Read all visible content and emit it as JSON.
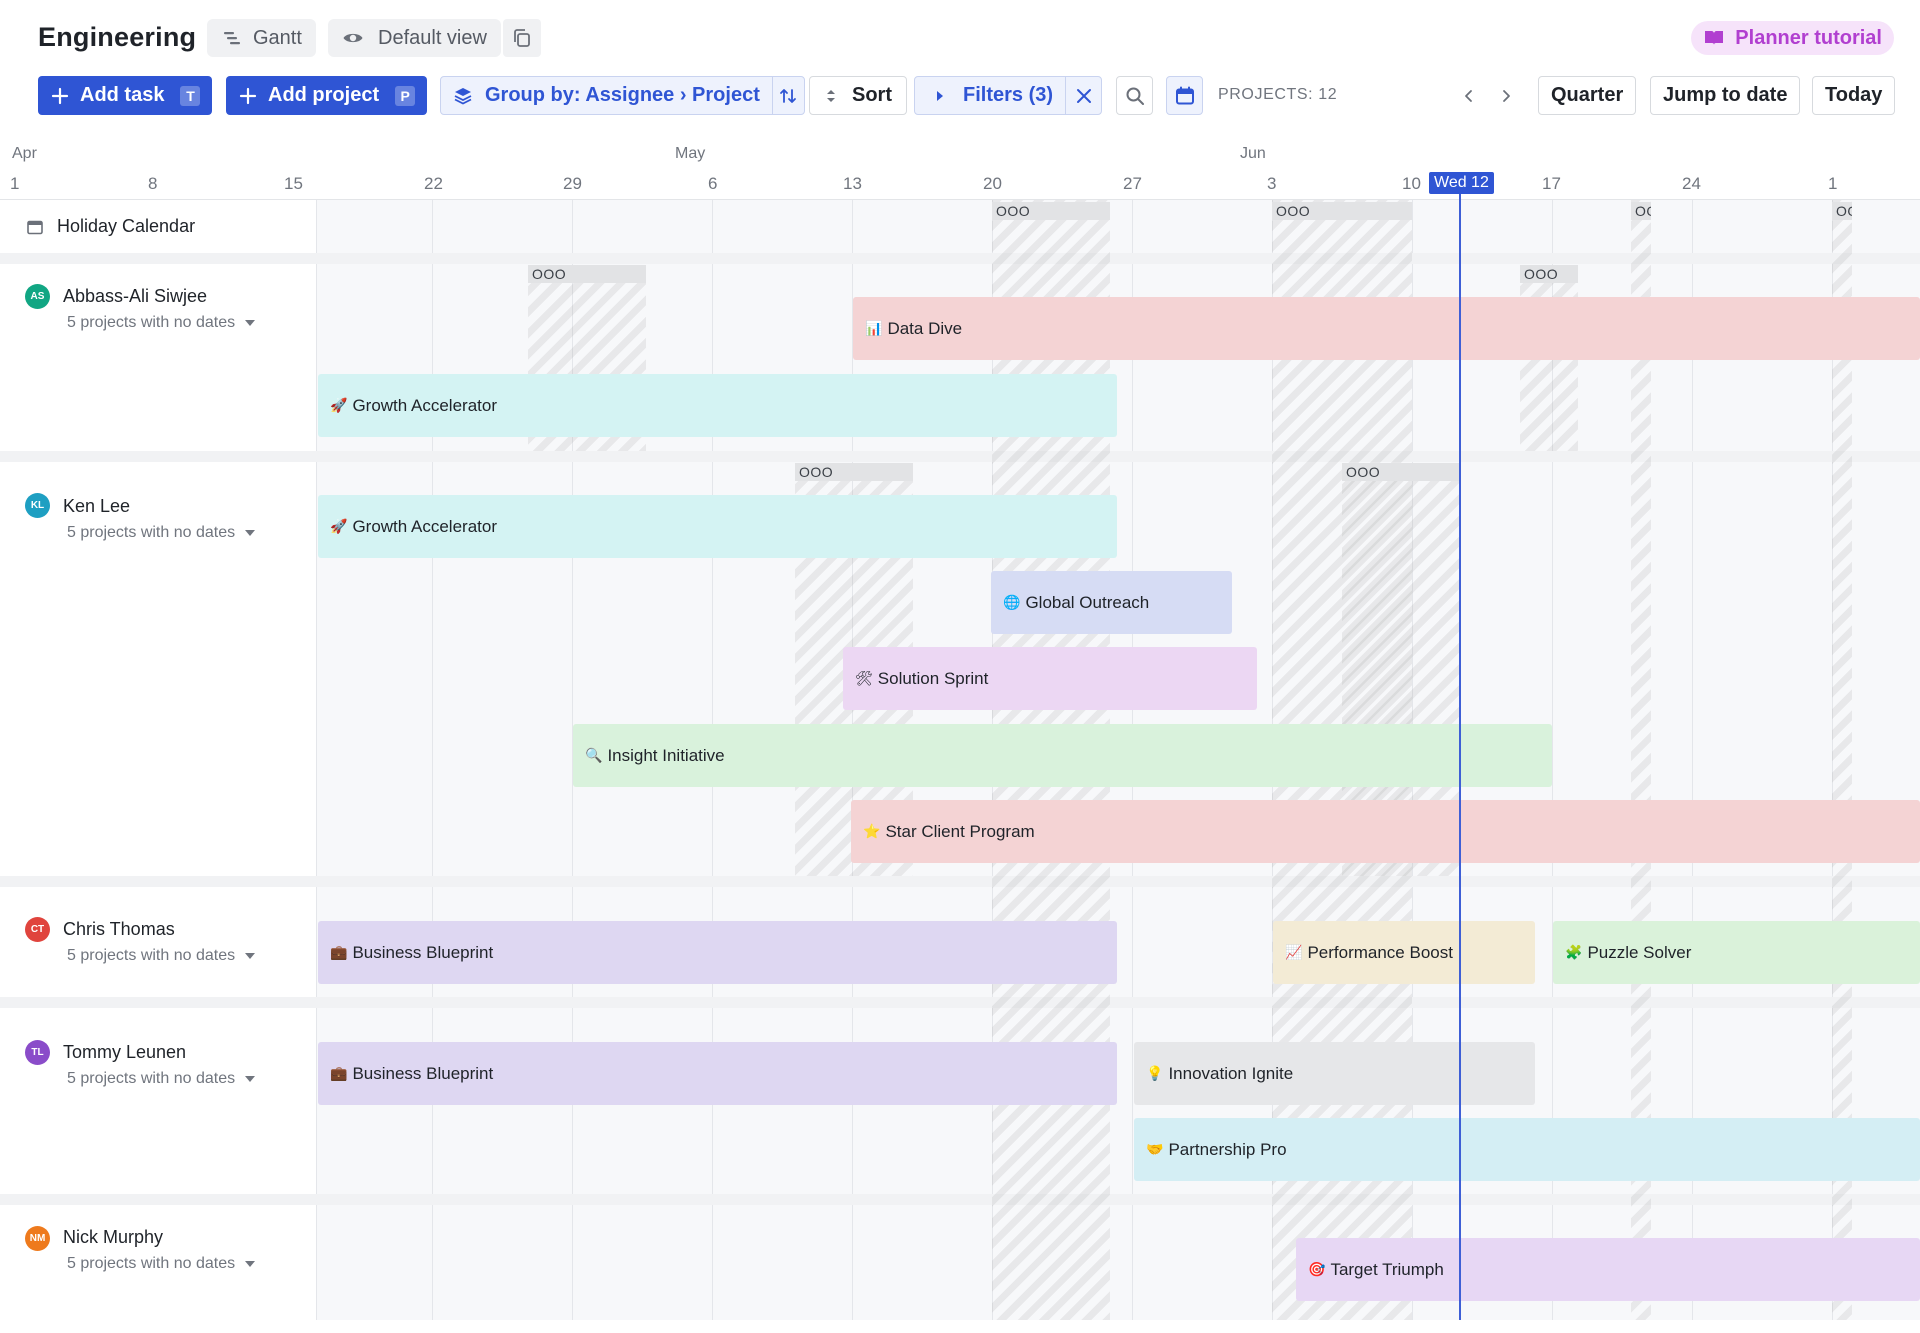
{
  "header": {
    "title": "Engineering",
    "gantt_label": "Gantt",
    "view_label": "Default view",
    "tutorial_label": "Planner tutorial"
  },
  "toolbar": {
    "add_task_label": "Add task",
    "add_task_key": "T",
    "add_project_label": "Add project",
    "add_project_key": "P",
    "group_label": "Group by: Assignee › Project",
    "sort_label": "Sort",
    "filters_label": "Filters (3)",
    "projects_count": "PROJECTS: 12",
    "quarter_label": "Quarter",
    "jump_label": "Jump to date",
    "today_label": "Today"
  },
  "timeline": {
    "months": [
      "Apr",
      "May",
      "Jun"
    ],
    "ticks": [
      "1",
      "8",
      "15",
      "22",
      "29",
      "6",
      "13",
      "20",
      "27",
      "3",
      "10",
      "17",
      "24",
      "1"
    ],
    "today_label": "Wed 12"
  },
  "holiday": {
    "label": "Holiday Calendar",
    "ooo_text": "OOO",
    "ooo_short": "OO"
  },
  "assignees": [
    {
      "initials": "AS",
      "name": "Abbass-Ali Siwjee",
      "sub": "5 projects with no dates",
      "color": "#11a683",
      "projects": [
        {
          "emoji": "📊",
          "name": "Data Dive",
          "color": "#f4d3d4"
        },
        {
          "emoji": "🚀",
          "name": "Growth Accelerator",
          "color": "#d4f3f3"
        }
      ]
    },
    {
      "initials": "KL",
      "name": "Ken Lee",
      "sub": "5 projects with no dates",
      "color": "#1e9fc2",
      "projects": [
        {
          "emoji": "🚀",
          "name": "Growth Accelerator",
          "color": "#d4f3f3"
        },
        {
          "emoji": "🌐",
          "name": "Global Outreach",
          "color": "#d6dcf4"
        },
        {
          "emoji": "🛠",
          "name": "Solution Sprint",
          "color": "#ecd7f3"
        },
        {
          "emoji": "🔍",
          "name": "Insight Initiative",
          "color": "#d9f2dc"
        },
        {
          "emoji": "⭐",
          "name": "Star Client Program",
          "color": "#f4d3d4"
        }
      ]
    },
    {
      "initials": "CT",
      "name": "Chris Thomas",
      "sub": "5 projects with no dates",
      "color": "#e0443d",
      "projects": [
        {
          "emoji": "💼",
          "name": "Business Blueprint",
          "color": "#ded7f2"
        },
        {
          "emoji": "📈",
          "name": "Performance Boost",
          "color": "#f3ebd5"
        },
        {
          "emoji": "🧩",
          "name": "Puzzle Solver",
          "color": "#daf2da"
        }
      ]
    },
    {
      "initials": "TL",
      "name": "Tommy Leunen",
      "sub": "5 projects with no dates",
      "color": "#8a4cc9",
      "projects": [
        {
          "emoji": "💼",
          "name": "Business Blueprint",
          "color": "#ded7f2"
        },
        {
          "emoji": "💡",
          "name": "Innovation Ignite",
          "color": "#e6e7e9"
        },
        {
          "emoji": "🤝",
          "name": "Partnership Pro",
          "color": "#d4eef4"
        }
      ]
    },
    {
      "initials": "NM",
      "name": "Nick Murphy",
      "sub": "5 projects with no dates",
      "color": "#ee7a1d",
      "projects": [
        {
          "emoji": "🎯",
          "name": "Target Triumph",
          "color": "#e7d7f4"
        }
      ]
    }
  ],
  "colors": {
    "accent": "#2f55d4",
    "today_line": "#3e5fd6",
    "tutorial_text": "#b13fd0",
    "tutorial_bg": "#f6e3fa"
  }
}
